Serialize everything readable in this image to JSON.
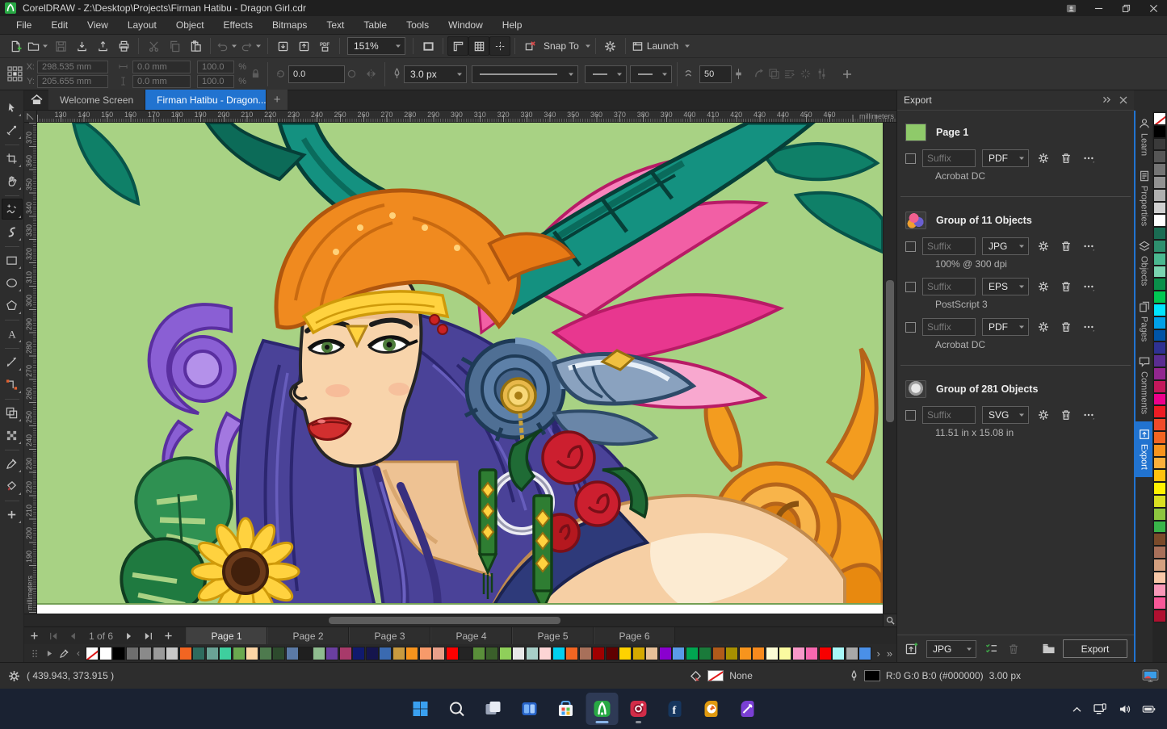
{
  "colors": {
    "accent_blue": "#2173d0",
    "canvas_green": "#a8d284",
    "taskbar_bg": "#1a2232",
    "chrome_bg": "#323232",
    "panel_bg": "#2f2f2f",
    "active_tab_blue": "#2173d0"
  },
  "window": {
    "title": "CorelDRAW - Z:\\Desktop\\Projects\\Firman Hatibu - Dragon Girl.cdr"
  },
  "menu": {
    "items": [
      "File",
      "Edit",
      "View",
      "Layout",
      "Object",
      "Effects",
      "Bitmaps",
      "Text",
      "Table",
      "Tools",
      "Window",
      "Help"
    ]
  },
  "std_toolbar": {
    "zoom_level": "151%",
    "snap_label": "Snap To",
    "launch_label": "Launch",
    "items": [
      {
        "icon": "new-document"
      },
      {
        "icon": "open-folder",
        "caret": true
      },
      {
        "icon": "save",
        "disabled": true
      },
      {
        "icon": "import-arrow"
      },
      {
        "icon": "export-arrow"
      },
      {
        "icon": "print"
      },
      {
        "sep": true
      },
      {
        "icon": "cut",
        "disabled": true
      },
      {
        "icon": "copy",
        "disabled": true
      },
      {
        "icon": "paste"
      },
      {
        "sep": true
      },
      {
        "icon": "undo",
        "disabled": true,
        "caret": true
      },
      {
        "icon": "redo",
        "disabled": true,
        "caret": true
      },
      {
        "sep": true
      },
      {
        "icon": "import-document"
      },
      {
        "icon": "export-document"
      },
      {
        "icon": "publish-pdf"
      },
      {
        "sep": true
      },
      {
        "zoom": true
      },
      {
        "sep": true
      },
      {
        "icon": "fullscreen-preview"
      },
      {
        "sep": true
      },
      {
        "icon": "show-rulers",
        "pressed": true
      },
      {
        "icon": "show-grid",
        "pressed": true
      },
      {
        "icon": "show-guidelines",
        "pressed": true
      },
      {
        "sep": true
      },
      {
        "icon": "snap-off"
      },
      {
        "snap": true
      },
      {
        "sep": true
      },
      {
        "icon": "options-gear"
      },
      {
        "sep": true
      },
      {
        "launch": true
      }
    ]
  },
  "property_bar": {
    "x_label": "X:",
    "y_label": "Y:",
    "x": "298.535 mm",
    "y": "205.655 mm",
    "width": "0.0 mm",
    "height": "0.0 mm",
    "scale_x": "100.0",
    "scale_y": "100.0",
    "percent": "%",
    "rotation": "0.0",
    "outline_width": "3.0 px",
    "smoothness": "50"
  },
  "document_tabs": {
    "tabs": [
      {
        "label": "Welcome Screen",
        "active": false
      },
      {
        "label": "Firman Hatibu - Dragon...",
        "active": true
      }
    ],
    "new_tab": "+"
  },
  "rulers": {
    "unit": "millimeters",
    "horizontal": [
      "130",
      "140",
      "150",
      "160",
      "170",
      "180",
      "190",
      "200",
      "210",
      "220",
      "230",
      "240",
      "250",
      "260",
      "270",
      "280",
      "290",
      "300",
      "310",
      "320",
      "330",
      "340",
      "350",
      "360",
      "370",
      "380",
      "390",
      "400",
      "410",
      "420",
      "430",
      "440",
      "450",
      "460"
    ],
    "vertical": [
      "370",
      "360",
      "350",
      "340",
      "330",
      "320",
      "310",
      "300",
      "290",
      "280",
      "270",
      "260",
      "250",
      "240",
      "230",
      "220",
      "210",
      "200",
      "190"
    ]
  },
  "toolbox": {
    "tools": [
      {
        "icon": "pick-tool"
      },
      {
        "icon": "shape-tool"
      },
      {
        "sep": true
      },
      {
        "icon": "crop-tool"
      },
      {
        "icon": "pan-tool"
      },
      {
        "sep": true
      },
      {
        "icon": "freehand-tool",
        "active": true
      },
      {
        "icon": "artistic-media-tool"
      },
      {
        "sep": true
      },
      {
        "icon": "rectangle-tool"
      },
      {
        "icon": "ellipse-tool"
      },
      {
        "icon": "polygon-tool"
      },
      {
        "sep": true
      },
      {
        "icon": "text-tool"
      },
      {
        "sep": true
      },
      {
        "icon": "dimension-tool"
      },
      {
        "icon": "connector-tool"
      },
      {
        "sep": true
      },
      {
        "icon": "contour-tool"
      },
      {
        "icon": "transparency-tool"
      },
      {
        "sep": true
      },
      {
        "icon": "eyedropper-tool"
      },
      {
        "icon": "interactive-fill-tool"
      },
      {
        "sep": true
      },
      {
        "icon": "add-tools"
      }
    ]
  },
  "export_panel": {
    "title": "Export",
    "suffix_placeholder": "Suffix",
    "groups": [
      {
        "title": "Page 1",
        "thumb": "th-page",
        "rows": [
          {
            "format": "PDF",
            "detail": "Acrobat DC"
          }
        ]
      },
      {
        "title": "Group of 11 Objects",
        "thumb": "th-color",
        "rows": [
          {
            "format": "JPG",
            "detail": "100% @ 300 dpi"
          },
          {
            "format": "EPS",
            "detail": "PostScript 3"
          },
          {
            "format": "PDF",
            "detail": "Acrobat DC"
          }
        ]
      },
      {
        "title": "Group of 281 Objects",
        "thumb": "th-gray",
        "rows": [
          {
            "format": "SVG",
            "detail": "11.51 in x 15.08 in"
          }
        ]
      }
    ],
    "footer": {
      "format": "JPG",
      "export_label": "Export"
    }
  },
  "dock": {
    "tabs": [
      {
        "label": "Learn",
        "icon": "learn"
      },
      {
        "label": "Properties",
        "icon": "properties"
      },
      {
        "label": "Objects",
        "icon": "objects"
      },
      {
        "label": "Pages",
        "icon": "pages"
      },
      {
        "label": "Comments",
        "icon": "comments"
      },
      {
        "label": "Export",
        "icon": "export-tab",
        "active": true
      }
    ]
  },
  "page_nav": {
    "counter": "1 of 6",
    "pages": [
      {
        "label": "Page 1",
        "active": true
      },
      {
        "label": "Page 2"
      },
      {
        "label": "Page 3"
      },
      {
        "label": "Page 4"
      },
      {
        "label": "Page 5"
      },
      {
        "label": "Page 6"
      }
    ]
  },
  "bottom_palette": {
    "colors": [
      "none",
      "#ffffff",
      "#000000",
      "#6e6e6e",
      "#8a8a8a",
      "#9a9a9a",
      "#c8c8c8",
      "#f26522",
      "#2e6b5e",
      "#6aa396",
      "#3ecf9e",
      "#6aa84f",
      "#fcd5a5",
      "#4e7a4e",
      "#2d4a2d",
      "#5b7aa6",
      "#1f1f1f",
      "#8fbc8f",
      "#6a3fa0",
      "#a83a6a",
      "#101a6e",
      "#15154d",
      "#3a6ab0",
      "#c89a3f",
      "#f7941d",
      "#f79a6a",
      "#e8a08a",
      "#ff0000",
      "#242424",
      "#5a8f3a",
      "#3a5f2a",
      "#8fcf5a",
      "#e8e8e8",
      "#a8cfc8",
      "#fcd5d5",
      "#00cfef",
      "#f26522",
      "#a8705a",
      "#a00000",
      "#600000",
      "#ffd200",
      "#d4a800",
      "#e8c098",
      "#8a00cf",
      "#5a9ae8",
      "#00a651",
      "#1a7a3a",
      "#b05a1a",
      "#a89000",
      "#f7941d",
      "#f78a1d",
      "#fcfcd5",
      "#fafaa0",
      "#f898c8",
      "#f868b0",
      "#f80000",
      "#a8f8f8",
      "#a8a8a8",
      "#4a90e8"
    ]
  },
  "side_palette": {
    "colors": [
      "none",
      "#000000",
      "#3a3a3a",
      "#565656",
      "#747474",
      "#929292",
      "#b0b0b0",
      "#d0d0d0",
      "#ffffff",
      "#1a6b52",
      "#2e8f6e",
      "#4ab890",
      "#7ad4b0",
      "#0a8f4a",
      "#00c853",
      "#00e5ff",
      "#00a0e8",
      "#0054a6",
      "#2e3192",
      "#5a2d91",
      "#92278f",
      "#c2185b",
      "#ec008c",
      "#ed1c24",
      "#f04a2a",
      "#f26522",
      "#f7941d",
      "#fbb03b",
      "#ffc20e",
      "#fff200",
      "#d9e021",
      "#8dc63f",
      "#39b54a",
      "#7a4a2a",
      "#a8705a",
      "#d4a080",
      "#f8c8a8",
      "#f898b8",
      "#f85898",
      "#b01030"
    ]
  },
  "status_bar": {
    "coordinates": "( 439.943, 373.915 )",
    "fill_value": "None",
    "outline_value": "R:0 G:0 B:0 (#000000)",
    "outline_width": "3.00 px"
  },
  "taskbar": {
    "apps": [
      {
        "name": "start"
      },
      {
        "name": "search"
      },
      {
        "name": "task-view"
      },
      {
        "name": "file-explorer"
      },
      {
        "name": "microsoft-store"
      },
      {
        "name": "coreldraw",
        "active": true
      },
      {
        "name": "corel-photo-paint",
        "running": true
      },
      {
        "name": "app-f"
      },
      {
        "name": "app-yellow"
      },
      {
        "name": "app-purple-pen"
      }
    ]
  }
}
